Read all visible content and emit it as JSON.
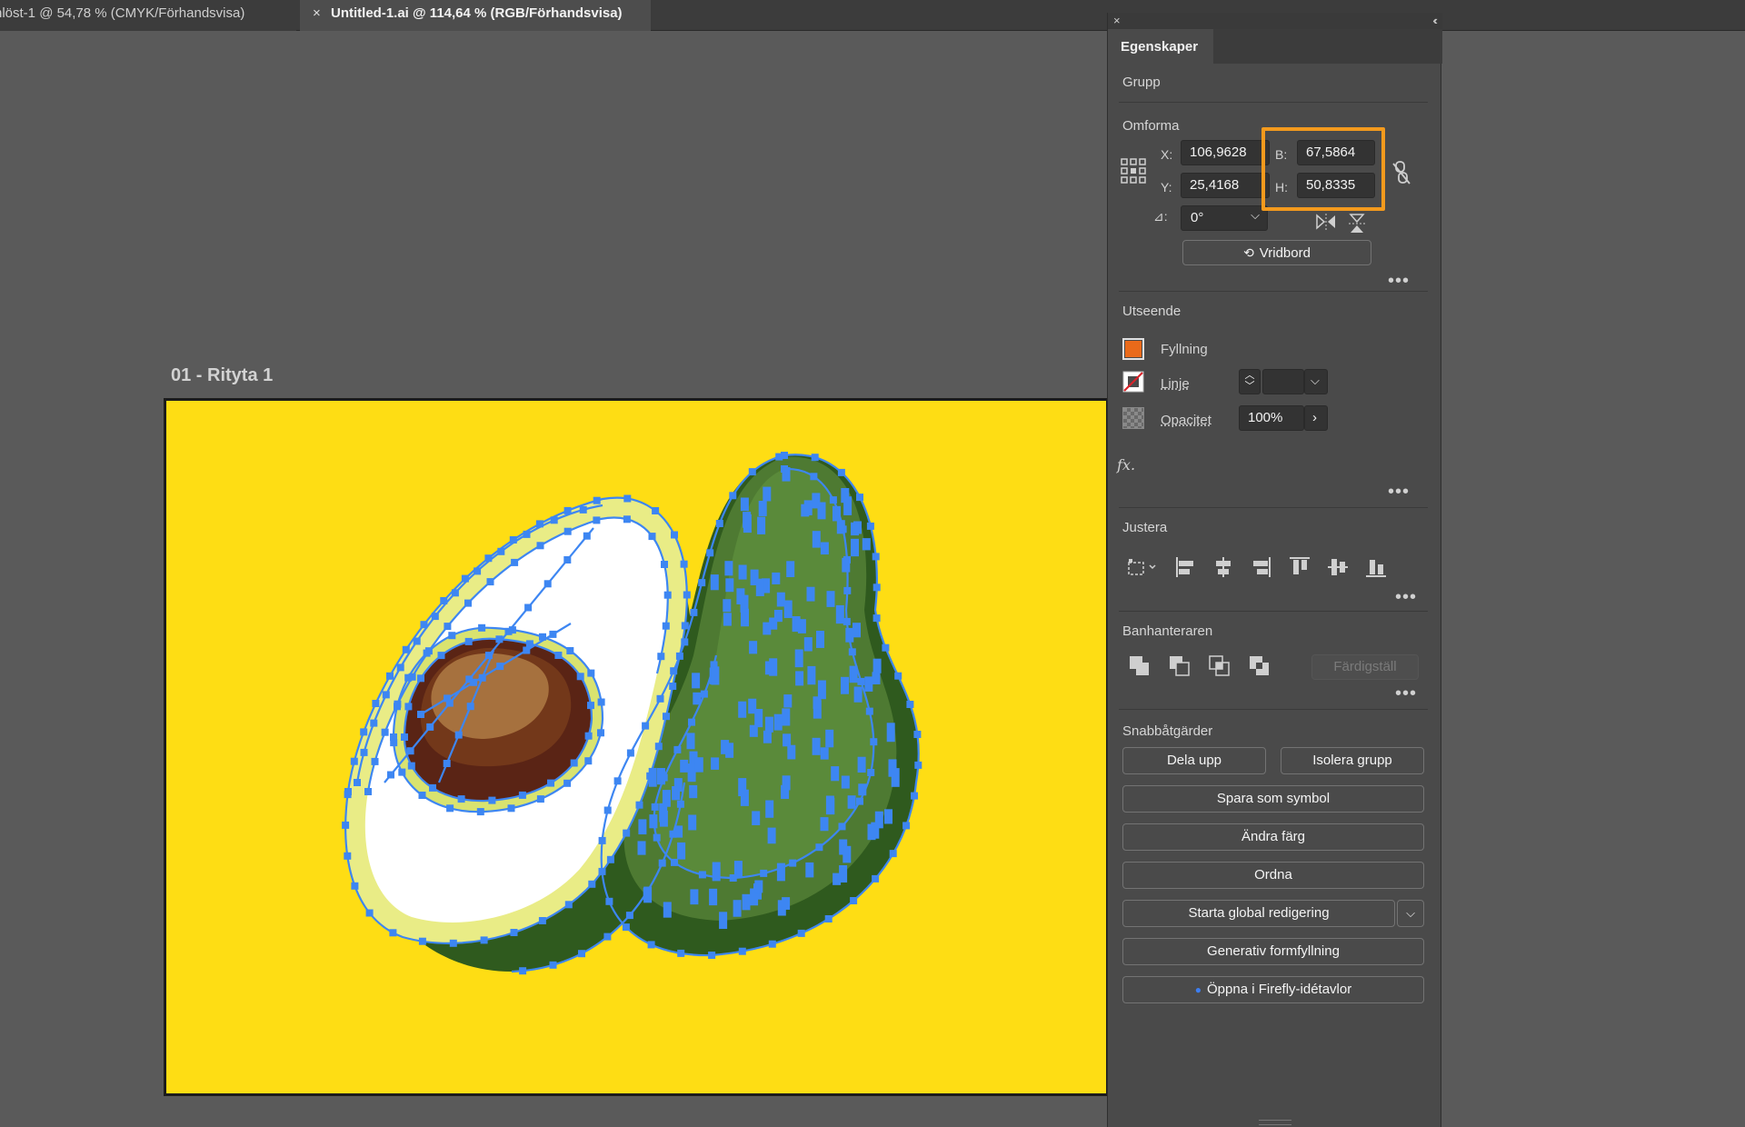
{
  "tabs": [
    {
      "label": "nlöst-1 @ 54,78 % (CMYK/Förhandsvisa)"
    },
    {
      "label": "Untitled-1.ai @ 114,64 % (RGB/Förhandsvisa)",
      "close": "×"
    }
  ],
  "artboard": {
    "label": "01 - Rityta 1",
    "background": "#fedd14"
  },
  "panel": {
    "close": "×",
    "collapse": "‹‹",
    "tab": "Egenskaper",
    "selection": "Grupp",
    "transform": {
      "title": "Omforma",
      "x_label": "X:",
      "x_value": "106,9628",
      "y_label": "Y:",
      "y_value": "25,4168",
      "w_label": "B:",
      "w_value": "67,5864",
      "h_label": "H:",
      "h_value": "50,8335",
      "angle_label": "⊿:",
      "angle_value": "0°",
      "vridbord": "Vridbord"
    },
    "appearance": {
      "title": "Utseende",
      "fill_label": "Fyllning",
      "fill_color": "#ea6a1a",
      "stroke_label": "Linje",
      "opacity_label": "Opacitet",
      "opacity_value": "100%",
      "fx": "fx."
    },
    "align": {
      "title": "Justera"
    },
    "pathfinder": {
      "title": "Banhanteraren",
      "expand": "Färdigställ"
    },
    "quick_actions": {
      "title": "Snabbåtgärder",
      "ungroup": "Dela upp",
      "isolate": "Isolera grupp",
      "save_symbol": "Spara som symbol",
      "recolor": "Ändra färg",
      "arrange": "Ordna",
      "global_edit": "Starta global redigering",
      "generative_fill": "Generativ formfyllning",
      "firefly": "Öppna i Firefly-idétavlor"
    },
    "colors": {
      "highlight": "#f39a1d",
      "anchor": "#3d86f2"
    }
  }
}
